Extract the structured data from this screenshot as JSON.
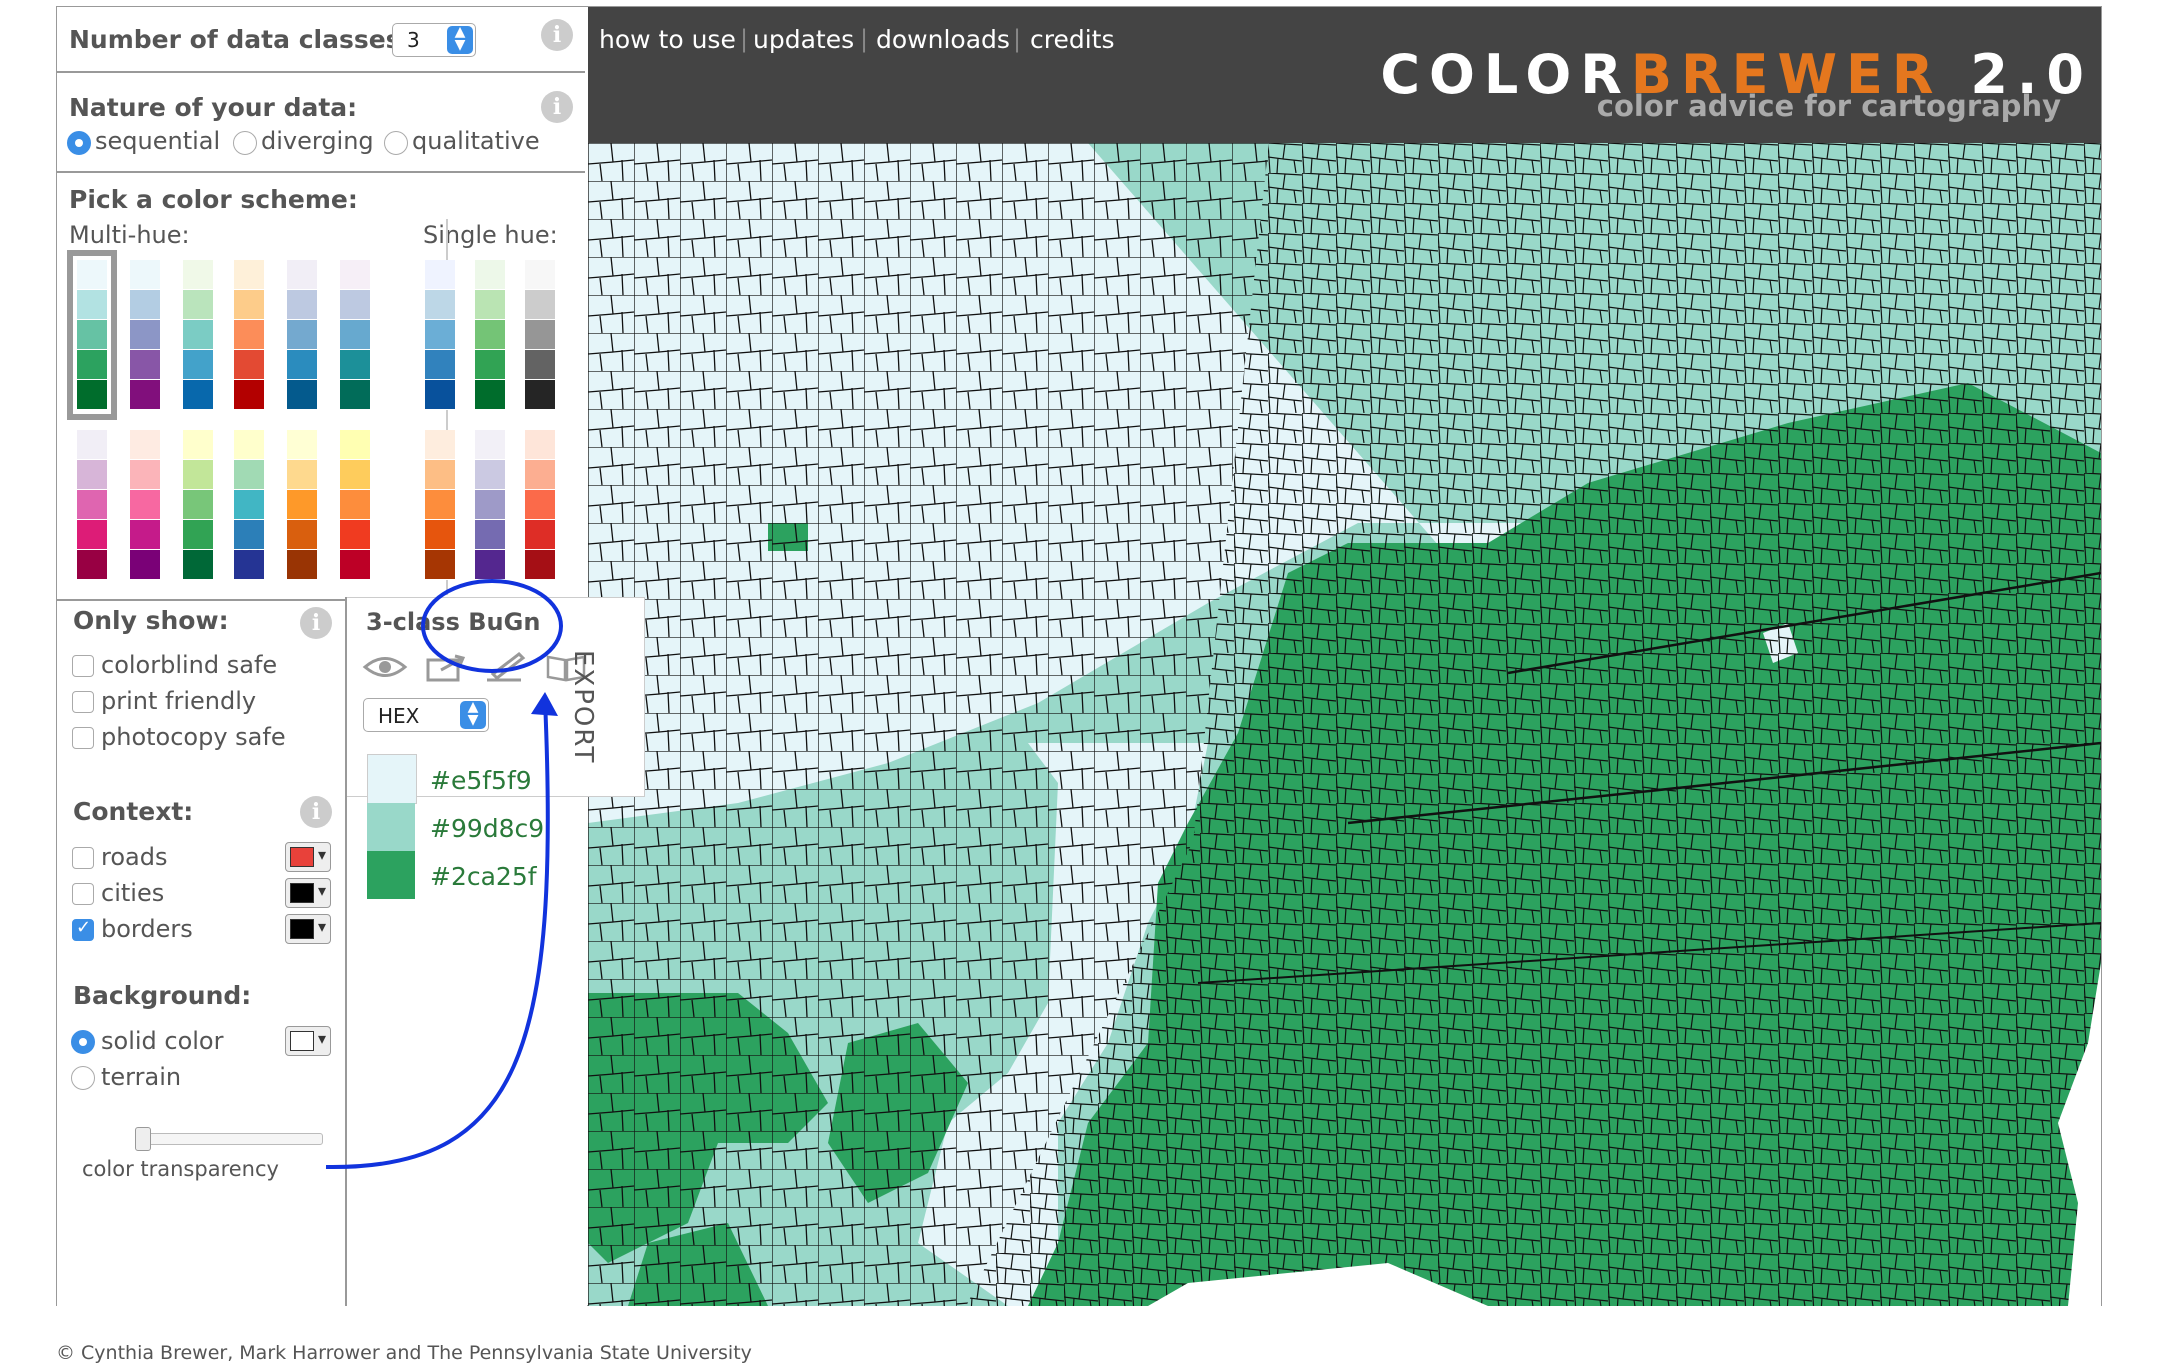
{
  "controls": {
    "num_classes_label": "Number of data classes:",
    "num_classes_value": "3",
    "nature_label": "Nature of your data:",
    "nature_options": [
      "sequential",
      "diverging",
      "qualitative"
    ],
    "nature_selected": "sequential",
    "pick_label": "Pick a color scheme:",
    "multi_hue_label": "Multi-hue:",
    "single_hue_label": "Single hue:"
  },
  "schemes": {
    "multi_hue_row1": [
      [
        "#edf8fb",
        "#b2e2e2",
        "#66c2a4",
        "#2ca25f",
        "#006d2c"
      ],
      [
        "#edf8fb",
        "#b3cde3",
        "#8c96c6",
        "#8856a7",
        "#810f7c"
      ],
      [
        "#f0f9e8",
        "#bae4bc",
        "#7bccc4",
        "#43a2ca",
        "#0868ac"
      ],
      [
        "#fef0d9",
        "#fdcc8a",
        "#fc8d59",
        "#e34a33",
        "#b30000"
      ],
      [
        "#f1eef6",
        "#bdc9e1",
        "#74a9cf",
        "#2b8cbe",
        "#045a8d"
      ],
      [
        "#f6eff7",
        "#bdc9e1",
        "#67a9cf",
        "#1c9099",
        "#016c59"
      ]
    ],
    "multi_hue_row2": [
      [
        "#f1eef6",
        "#d7b5d8",
        "#df65b0",
        "#dd1c77",
        "#980043"
      ],
      [
        "#feebe2",
        "#fbb4b9",
        "#f768a1",
        "#c51b8a",
        "#7a0177"
      ],
      [
        "#ffffcc",
        "#c2e699",
        "#78c679",
        "#31a354",
        "#006837"
      ],
      [
        "#ffffcc",
        "#a1dab4",
        "#41b6c4",
        "#2c7fb8",
        "#253494"
      ],
      [
        "#ffffd4",
        "#fed98e",
        "#fe9929",
        "#d95f0e",
        "#993404"
      ],
      [
        "#ffffb2",
        "#fecc5c",
        "#fd8d3c",
        "#f03b20",
        "#bd0026"
      ]
    ],
    "single_hue_row1": [
      [
        "#eff3ff",
        "#bdd7e7",
        "#6baed6",
        "#3182bd",
        "#08519c"
      ],
      [
        "#edf8e9",
        "#bae4b3",
        "#74c476",
        "#31a354",
        "#006d2c"
      ],
      [
        "#f7f7f7",
        "#cccccc",
        "#969696",
        "#636363",
        "#252525"
      ]
    ],
    "single_hue_row2": [
      [
        "#feedde",
        "#fdbe85",
        "#fd8d3c",
        "#e6550d",
        "#a63603"
      ],
      [
        "#f2f0f7",
        "#cbc9e2",
        "#9e9ac8",
        "#756bb1",
        "#54278f"
      ],
      [
        "#fee5d9",
        "#fcae91",
        "#fb6a4a",
        "#de2d26",
        "#a50f15"
      ]
    ]
  },
  "filters": {
    "only_show_label": "Only show:",
    "options": [
      "colorblind safe",
      "print friendly",
      "photocopy safe"
    ]
  },
  "context": {
    "label": "Context:",
    "items": [
      {
        "label": "roads",
        "checked": false,
        "color": "#e8413a"
      },
      {
        "label": "cities",
        "checked": false,
        "color": "#000000"
      },
      {
        "label": "borders",
        "checked": true,
        "color": "#000000"
      }
    ]
  },
  "background": {
    "label": "Background:",
    "options": [
      "solid color",
      "terrain"
    ],
    "selected": "solid color",
    "color": "#ffffff",
    "transparency_label": "color transparency"
  },
  "export": {
    "title": "3-class BuGn",
    "format": "HEX",
    "tab_label": "EXPORT",
    "colors": [
      "#e5f5f9",
      "#99d8c9",
      "#2ca25f"
    ]
  },
  "header": {
    "nav": [
      "how to use",
      "updates",
      "downloads",
      "credits"
    ],
    "brand_white": "COLOR",
    "brand_orange": "BREWER",
    "brand_version": "2.0",
    "tagline": "color advice for cartography"
  },
  "footer": {
    "copyright": "© Cynthia Brewer, Mark Harrower and The Pennsylvania State University"
  }
}
